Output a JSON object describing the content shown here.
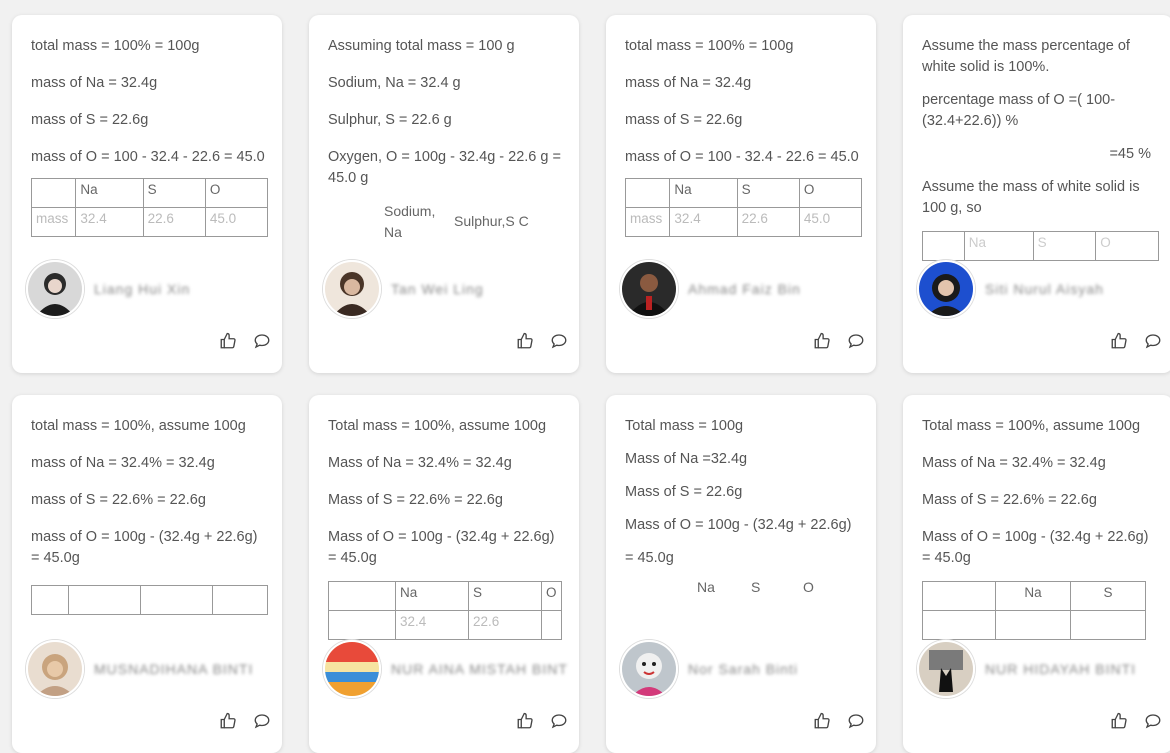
{
  "cards": [
    {
      "lines": [
        "total mass = 100% = 100g",
        "mass of Na = 32.4g",
        "mass of S = 22.6g",
        "mass of O = 100 - 32.4 - 22.6 = 45.0"
      ],
      "table": {
        "header": [
          "",
          "Na",
          "S",
          "O"
        ],
        "row": [
          "mass",
          "32.4",
          "22.6",
          "45.0"
        ]
      },
      "author": "Liang Hui Xin"
    },
    {
      "lines": [
        "Assuming total mass = 100 g",
        "Sodium, Na = 32.4 g",
        "Sulphur, S = 22.6 g",
        "Oxygen, O = 100g - 32.4g - 22.6 g = 45.0 g"
      ],
      "inline_headers": [
        "Sodium, Na",
        "Sulphur,S C"
      ],
      "author": "Tan Wei Ling"
    },
    {
      "lines": [
        "total mass = 100% = 100g",
        "mass of Na = 32.4g",
        "mass of S = 22.6g",
        "mass of O = 100 - 32.4 - 22.6 = 45.0"
      ],
      "table": {
        "header": [
          "",
          "Na",
          "S",
          "O"
        ],
        "row": [
          "mass",
          "32.4",
          "22.6",
          "45.0"
        ]
      },
      "author": "Ahmad Faiz Bin"
    },
    {
      "lines": [
        "Assume the mass percentage of white solid is 100%.",
        "percentage mass of O =( 100-(32.4+22.6)) %",
        "=45 %",
        "Assume the mass of white solid is 100 g, so"
      ],
      "table": {
        "header": [
          "",
          "Na",
          "S",
          "O"
        ],
        "row": [
          "",
          "",
          "",
          ""
        ]
      },
      "author": "Siti Nurul Aisyah"
    },
    {
      "lines": [
        "total mass = 100%, assume 100g",
        "mass of Na = 32.4% = 32.4g",
        "mass of S = 22.6% = 22.6g",
        "mass of O = 100g - (32.4g + 22.6g) = 45.0g"
      ],
      "table": {
        "header": [
          "",
          "",
          "",
          ""
        ],
        "row": [
          "",
          "",
          "",
          ""
        ]
      },
      "author": "MUSNADIHANA BINTI"
    },
    {
      "lines": [
        "Total mass = 100%, assume 100g",
        "Mass of Na = 32.4% = 32.4g",
        "Mass of S = 22.6% = 22.6g",
        "Mass of O = 100g - (32.4g + 22.6g) = 45.0g"
      ],
      "table": {
        "header": [
          "",
          "Na",
          "S",
          "O"
        ],
        "row": [
          "",
          "32.4",
          "22.6",
          ""
        ]
      },
      "author": "NUR AINA MISTAH BINT"
    },
    {
      "lines": [
        "Total mass = 100g",
        "Mass of Na =32.4g",
        "Mass of S = 22.6g",
        "Mass of O = 100g - (32.4g + 22.6g)",
        "= 45.0g"
      ],
      "inline_headers": [
        "Na",
        "S",
        "O"
      ],
      "author": "Nor Sarah Binti"
    },
    {
      "lines": [
        "Total mass = 100%, assume 100g",
        "Mass of Na = 32.4% = 32.4g",
        "Mass of S = 22.6% = 22.6g",
        "Mass of O = 100g - (32.4g + 22.6g) = 45.0g"
      ],
      "table": {
        "header": [
          "",
          "Na",
          "S"
        ],
        "row": [
          "",
          "",
          ""
        ]
      },
      "author": "NUR HIDAYAH BINTI"
    }
  ],
  "colors": {
    "background": "#f1f1f1",
    "card": "#ffffff",
    "icon": "#444444"
  },
  "icons": {
    "like": "thumbs-up-icon",
    "comment": "comment-icon"
  }
}
